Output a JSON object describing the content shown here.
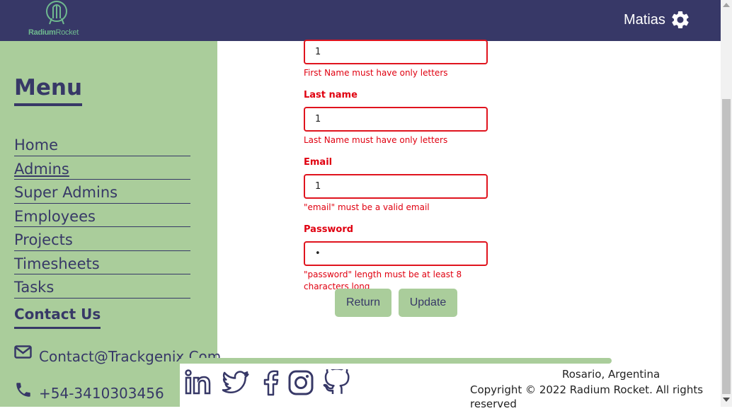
{
  "header": {
    "logo_text_bold": "Radium",
    "logo_text_light": "Rocket",
    "user_name": "Matias",
    "settings_icon": "gear-icon"
  },
  "sidebar": {
    "title": "Menu",
    "items": [
      {
        "label": "Home"
      },
      {
        "label": "Admins"
      },
      {
        "label": "Super Admins"
      },
      {
        "label": "Employees"
      },
      {
        "label": "Projects"
      },
      {
        "label": "Timesheets"
      },
      {
        "label": "Tasks"
      }
    ],
    "contact_title": "Contact Us",
    "email": "Contact@Trackgenix.Com",
    "phone": "+54-3410303456"
  },
  "form": {
    "first_name": {
      "value": "1",
      "error": "First Name must have only letters"
    },
    "last_name": {
      "label": "Last name",
      "value": "1",
      "error": "Last Name must have only letters"
    },
    "email": {
      "label": "Email",
      "value": "1",
      "error": "\"email\" must be a valid email"
    },
    "password": {
      "label": "Password",
      "value": "•",
      "error": "\"password\" length must be at least 8 characters long"
    },
    "return_label": "Return",
    "update_label": "Update"
  },
  "footer": {
    "social": [
      "linkedin-icon",
      "twitter-icon",
      "facebook-icon",
      "instagram-icon",
      "github-icon"
    ],
    "location": "Rosario, Argentina",
    "copyright": "Copyright © 2022 Radium Rocket. All rights reserved"
  },
  "colors": {
    "primary": "#373867",
    "accent": "#aacd9b",
    "error": "#e00010"
  }
}
